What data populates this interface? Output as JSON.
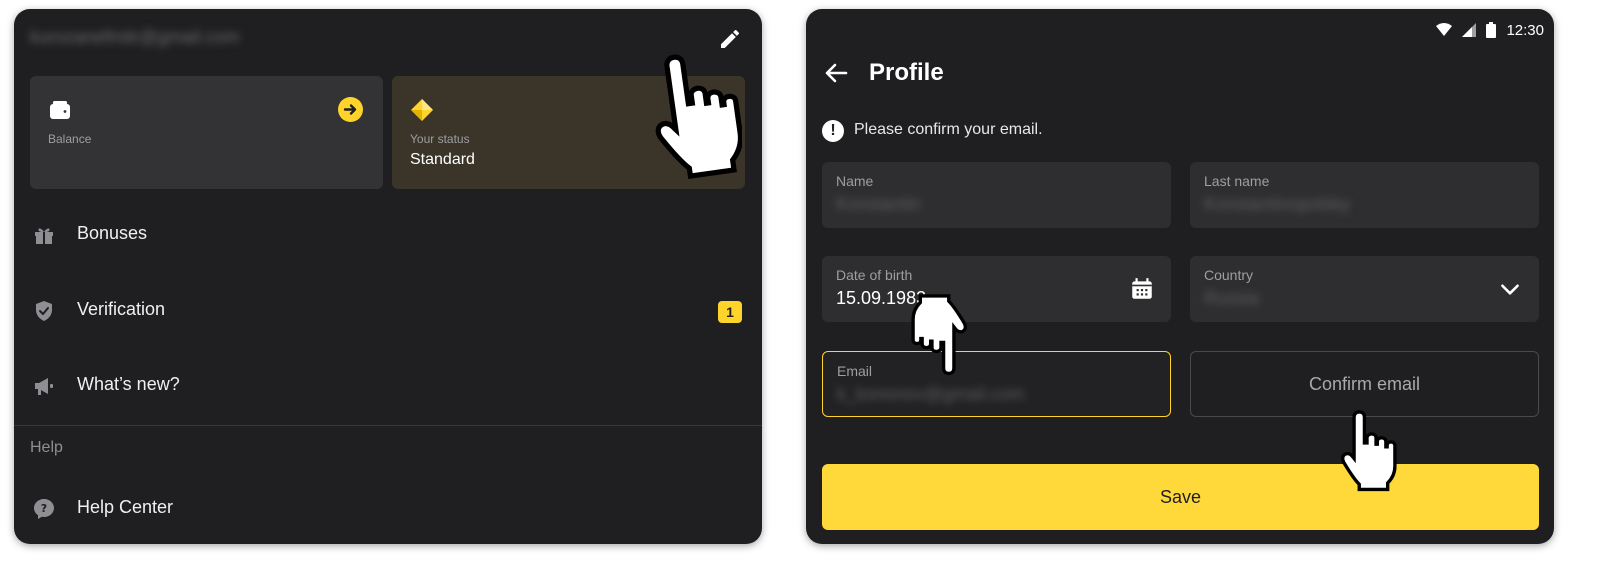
{
  "left_panel": {
    "user_email": "kurozanefmitr@gmail.com",
    "balance": {
      "label": "Balance"
    },
    "status": {
      "label": "Your status",
      "value": "Standard"
    },
    "menu": [
      {
        "label": "Bonuses",
        "icon": "gift-icon"
      },
      {
        "label": "Verification",
        "icon": "shield-check-icon",
        "badge": "1"
      },
      {
        "label": "What’s new?",
        "icon": "megaphone-icon"
      }
    ],
    "help_section": {
      "header": "Help",
      "items": [
        {
          "label": "Help Center",
          "icon": "help-circle-icon"
        }
      ]
    }
  },
  "right_panel": {
    "status_bar": {
      "time": "12:30"
    },
    "title": "Profile",
    "notice": "Please confirm your email.",
    "fields": {
      "name": {
        "label": "Name",
        "value": "Konstantin"
      },
      "last_name": {
        "label": "Last name",
        "value": "Konstantinopolsky"
      },
      "dob": {
        "label": "Date of birth",
        "value": "15.09.1983"
      },
      "country": {
        "label": "Country",
        "value": "Russia"
      },
      "email": {
        "label": "Email",
        "value": "k_kononov@gmail.com"
      }
    },
    "confirm_email_button": "Confirm email",
    "save_button": "Save"
  },
  "colors": {
    "accent": "#ffd42a",
    "panel_bg": "#1f1f21",
    "card_bg": "#333335"
  }
}
